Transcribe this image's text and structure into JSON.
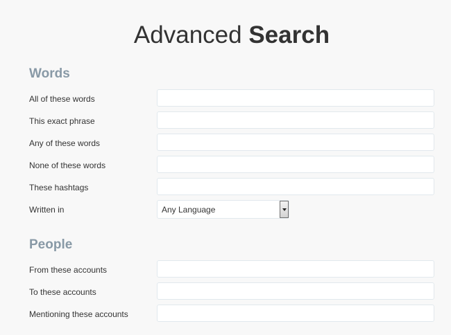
{
  "page": {
    "title_light": "Advanced",
    "title_bold": "Search"
  },
  "words": {
    "heading": "Words",
    "all_label": "All of these words",
    "all_value": "",
    "exact_label": "This exact phrase",
    "exact_value": "",
    "any_label": "Any of these words",
    "any_value": "",
    "none_label": "None of these words",
    "none_value": "",
    "hashtags_label": "These hashtags",
    "hashtags_value": "",
    "language_label": "Written in",
    "language_selected": "Any Language",
    "language_arrow_icon": "chevron-down-icon"
  },
  "people": {
    "heading": "People",
    "from_label": "From these accounts",
    "from_value": "",
    "to_label": "To these accounts",
    "to_value": "",
    "mentioning_label": "Mentioning these accounts",
    "mentioning_value": ""
  },
  "colors": {
    "background": "#f8f8f8",
    "section_heading": "#8899a6",
    "text": "#333333",
    "input_border": "#e1e8ed",
    "input_background": "#ffffff"
  }
}
